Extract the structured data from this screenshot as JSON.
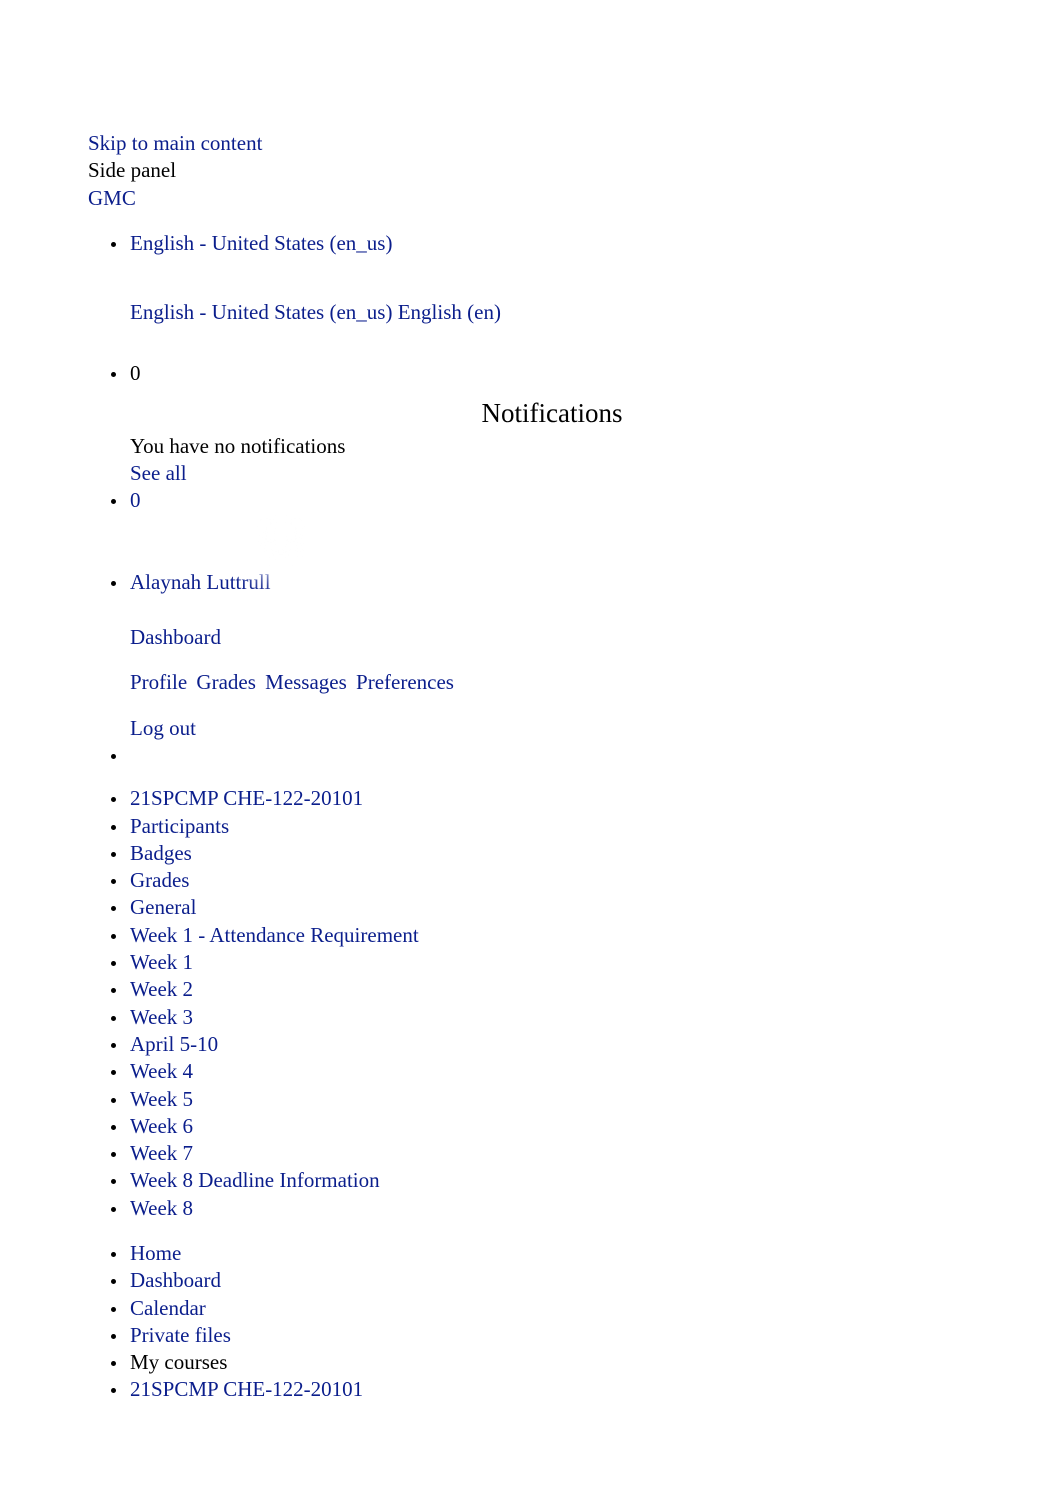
{
  "top": {
    "skip_link": "Skip to main content",
    "side_panel": "Side panel",
    "brand": "GMC"
  },
  "lang": {
    "current": "English - United States (en_us)",
    "option_en_us": "English - United States (en_us)",
    "option_en": "English (en)"
  },
  "notifications": {
    "count": "0",
    "heading": "Notifications",
    "empty": "You have no notifications",
    "see_all": "See all"
  },
  "messages": {
    "count": "0"
  },
  "user": {
    "name": "Alaynah Luttrull",
    "menu": {
      "dashboard": "Dashboard",
      "profile": "Profile",
      "grades": "Grades",
      "messages": "Messages",
      "preferences": "Preferences",
      "logout": "Log out"
    }
  },
  "course_nav": [
    "21SPCMP CHE-122-20101",
    "Participants",
    "Badges",
    "Grades",
    "General",
    "Week 1 - Attendance Requirement",
    "Week 1",
    "Week 2",
    "Week 3",
    "April 5-10",
    "Week 4",
    "Week 5",
    "Week 6",
    "Week 7",
    "Week 8 Deadline Information",
    "Week 8"
  ],
  "site_nav": {
    "home": "Home",
    "dashboard": "Dashboard",
    "calendar": "Calendar",
    "private_files": "Private files",
    "my_courses": "My courses",
    "course_code": "21SPCMP CHE-122-20101"
  }
}
